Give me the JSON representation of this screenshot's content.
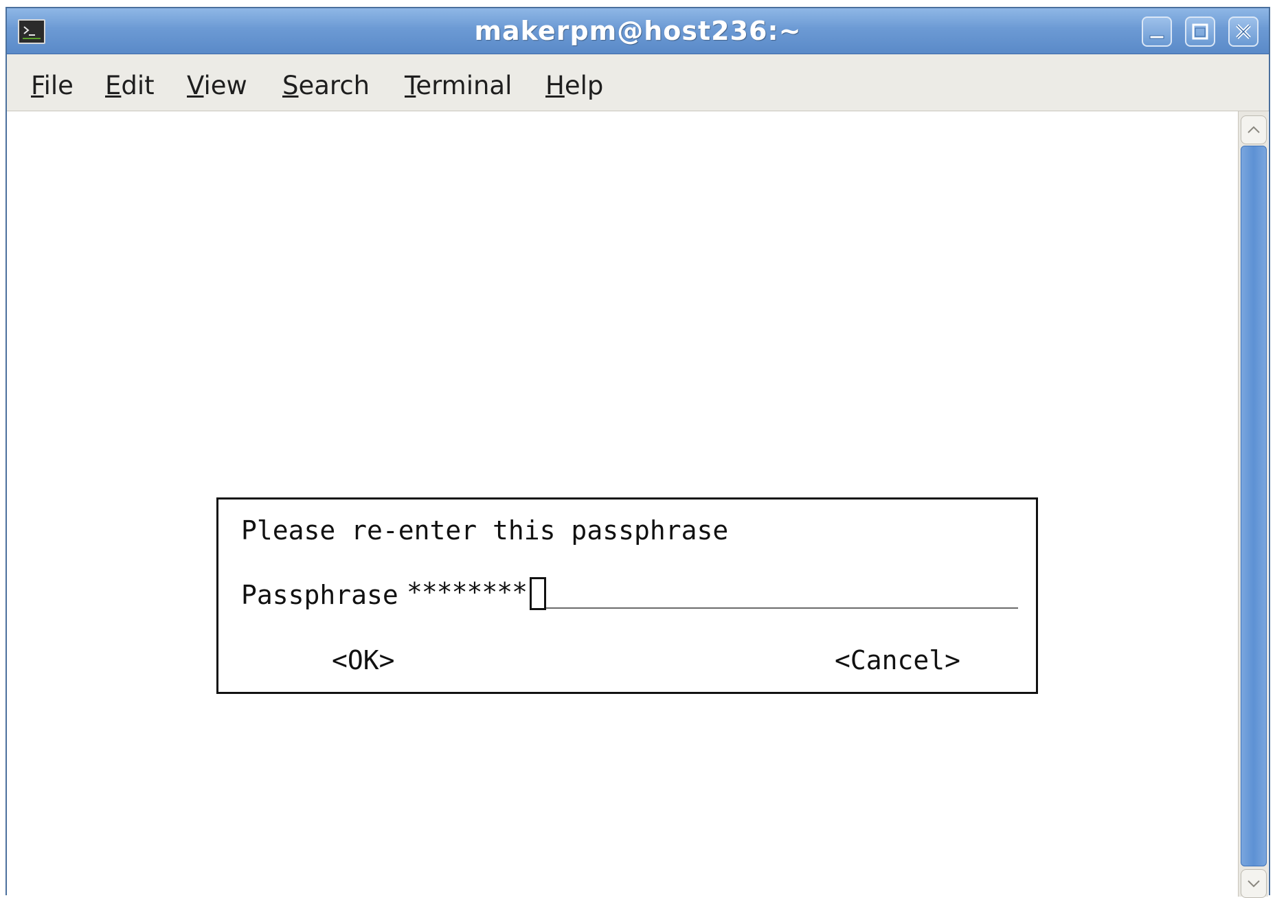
{
  "window": {
    "title": "makerpm@host236:~",
    "icon": "terminal-icon",
    "controls": [
      "minimize-icon",
      "maximize-icon",
      "close-icon"
    ]
  },
  "menubar": {
    "items": [
      {
        "label": "File",
        "mnemonic": "F",
        "rest": "ile"
      },
      {
        "label": "Edit",
        "mnemonic": "E",
        "rest": "dit"
      },
      {
        "label": "View",
        "mnemonic": "V",
        "rest": "iew"
      },
      {
        "label": "Search",
        "mnemonic": "S",
        "rest": "earch"
      },
      {
        "label": "Terminal",
        "mnemonic": "T",
        "rest": "erminal"
      },
      {
        "label": "Help",
        "mnemonic": "H",
        "rest": "elp"
      }
    ]
  },
  "dialog": {
    "prompt": "Please re-enter this passphrase",
    "field_label": "Passphrase",
    "field_value": "********",
    "ok_label": "<OK>",
    "cancel_label": "<Cancel>"
  },
  "colors": {
    "titlebar": "#6c9ad4",
    "menubar": "#ecebe6",
    "scroll_thumb": "#5d91d4",
    "terminal_bg": "#ffffff",
    "text": "#111111"
  }
}
